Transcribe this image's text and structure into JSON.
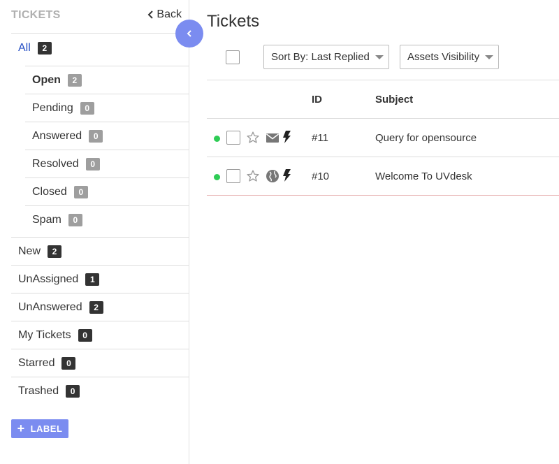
{
  "sidebar": {
    "title": "TICKETS",
    "back_label": "Back",
    "all": {
      "label": "All",
      "count": "2"
    },
    "status_items": [
      {
        "label": "Open",
        "count": "2"
      },
      {
        "label": "Pending",
        "count": "0"
      },
      {
        "label": "Answered",
        "count": "0"
      },
      {
        "label": "Resolved",
        "count": "0"
      },
      {
        "label": "Closed",
        "count": "0"
      },
      {
        "label": "Spam",
        "count": "0"
      }
    ],
    "filter_items": [
      {
        "label": "New",
        "count": "2"
      },
      {
        "label": "UnAssigned",
        "count": "1"
      },
      {
        "label": "UnAnswered",
        "count": "2"
      },
      {
        "label": "My Tickets",
        "count": "0"
      },
      {
        "label": "Starred",
        "count": "0"
      },
      {
        "label": "Trashed",
        "count": "0"
      }
    ],
    "label_button": "LABEL"
  },
  "main": {
    "title": "Tickets",
    "sort_dropdown": "Sort By: Last Replied",
    "assets_dropdown": "Assets Visibility",
    "columns": {
      "id": "ID",
      "subject": "Subject"
    },
    "tickets": [
      {
        "id": "#11",
        "subject": "Query for opensource",
        "source_icon": "email-icon"
      },
      {
        "id": "#10",
        "subject": "Welcome To UVdesk",
        "source_icon": "globe-icon"
      }
    ]
  },
  "colors": {
    "accent": "#7b8cf0",
    "link_active": "#2750c4",
    "status_dot": "#2ecc55"
  }
}
